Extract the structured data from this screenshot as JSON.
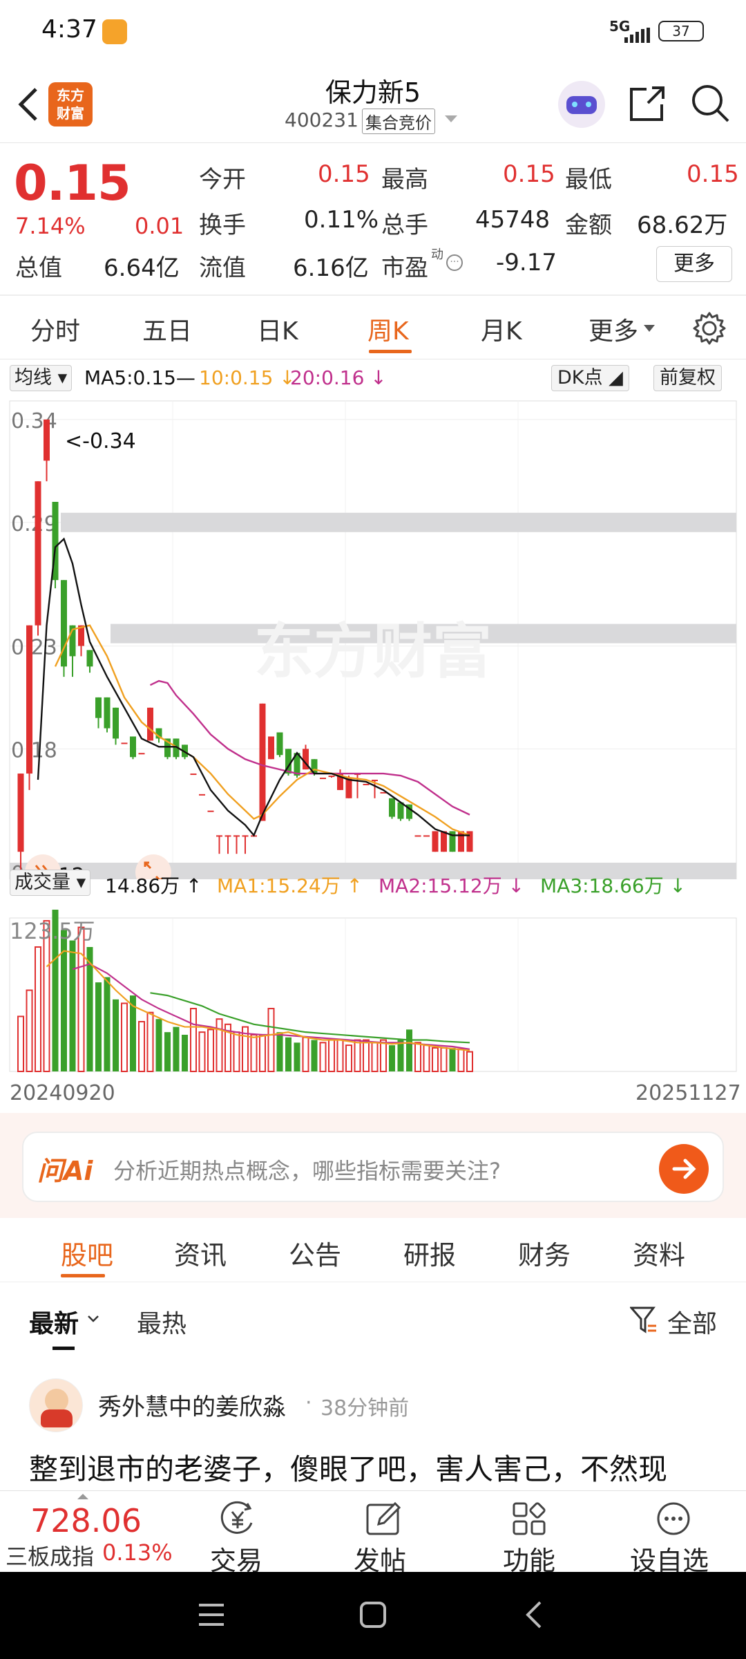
{
  "status_bar": {
    "time": "4:37",
    "network": "5G",
    "battery": "37"
  },
  "header": {
    "title": "保力新5",
    "code": "400231",
    "badge": "集合竞价",
    "logo_text": "东方财富"
  },
  "quote": {
    "price": "0.15",
    "change_pct": "7.14%",
    "change": "0.01",
    "fields": [
      {
        "label": "今开",
        "value": "0.15"
      },
      {
        "label": "最高",
        "value": "0.15"
      },
      {
        "label": "最低",
        "value": "0.15"
      },
      {
        "label": "换手",
        "value": "0.11%"
      },
      {
        "label": "总手",
        "value": "45748"
      },
      {
        "label": "金额",
        "value": "68.62万"
      },
      {
        "label": "总值",
        "value": "6.64亿"
      },
      {
        "label": "流值",
        "value": "6.16亿"
      },
      {
        "label": "市盈",
        "value": "-9.17"
      }
    ],
    "pe_sup": "动",
    "more_button": "更多"
  },
  "period_tabs": [
    "分时",
    "五日",
    "日K",
    "周K",
    "月K",
    "更多"
  ],
  "active_tab": "周K",
  "chart_toolbar": {
    "ma_select": "均线",
    "ma5": "MA5:0.15—",
    "ma10": "10:0.15 ↓",
    "ma20": "20:0.16 ↓",
    "dk": "DK点",
    "adjust": "前复权"
  },
  "chart_data": {
    "type": "candlestick",
    "y_ticks": [
      "0.34",
      "0.29",
      "0.23",
      "0.18",
      "0.12"
    ],
    "ylim": [
      0.12,
      0.345
    ],
    "max_label": "<-0.34",
    "min_label": "<-0.12",
    "watermark": "东方财富",
    "candles": [
      {
        "o": 0.13,
        "h": 0.168,
        "l": 0.12,
        "c": 0.168
      },
      {
        "o": 0.168,
        "h": 0.24,
        "l": 0.16,
        "c": 0.24
      },
      {
        "o": 0.24,
        "h": 0.31,
        "l": 0.235,
        "c": 0.31
      },
      {
        "o": 0.32,
        "h": 0.34,
        "l": 0.31,
        "c": 0.34
      },
      {
        "o": 0.3,
        "h": 0.3,
        "l": 0.258,
        "c": 0.262
      },
      {
        "o": 0.262,
        "h": 0.262,
        "l": 0.215,
        "c": 0.22
      },
      {
        "o": 0.24,
        "h": 0.24,
        "l": 0.215,
        "c": 0.225
      },
      {
        "o": 0.23,
        "h": 0.24,
        "l": 0.225,
        "c": 0.24
      },
      {
        "o": 0.228,
        "h": 0.228,
        "l": 0.217,
        "c": 0.22
      },
      {
        "o": 0.205,
        "h": 0.205,
        "l": 0.19,
        "c": 0.195
      },
      {
        "o": 0.205,
        "h": 0.205,
        "l": 0.188,
        "c": 0.19
      },
      {
        "o": 0.2,
        "h": 0.2,
        "l": 0.182,
        "c": 0.185
      },
      {
        "o": 0.183,
        "h": 0.183,
        "l": 0.183,
        "c": 0.183
      },
      {
        "o": 0.186,
        "h": 0.186,
        "l": 0.175,
        "c": 0.176
      },
      {
        "o": 0.178,
        "h": 0.178,
        "l": 0.178,
        "c": 0.178
      },
      {
        "o": 0.184,
        "h": 0.2,
        "l": 0.184,
        "c": 0.2
      },
      {
        "o": 0.19,
        "h": 0.19,
        "l": 0.183,
        "c": 0.185
      },
      {
        "o": 0.185,
        "h": 0.185,
        "l": 0.175,
        "c": 0.176
      },
      {
        "o": 0.185,
        "h": 0.185,
        "l": 0.175,
        "c": 0.176
      },
      {
        "o": 0.182,
        "h": 0.182,
        "l": 0.175,
        "c": 0.176
      },
      {
        "o": 0.168,
        "h": 0.168,
        "l": 0.168,
        "c": 0.168
      },
      {
        "o": 0.158,
        "h": 0.158,
        "l": 0.158,
        "c": 0.158
      },
      {
        "o": 0.15,
        "h": 0.15,
        "l": 0.15,
        "c": 0.15
      },
      {
        "o": 0.138,
        "h": 0.138,
        "l": 0.129,
        "c": 0.138
      },
      {
        "o": 0.138,
        "h": 0.138,
        "l": 0.129,
        "c": 0.138
      },
      {
        "o": 0.138,
        "h": 0.138,
        "l": 0.129,
        "c": 0.138
      },
      {
        "o": 0.138,
        "h": 0.138,
        "l": 0.129,
        "c": 0.138
      },
      {
        "o": 0.138,
        "h": 0.138,
        "l": 0.138,
        "c": 0.138
      },
      {
        "o": 0.145,
        "h": 0.202,
        "l": 0.145,
        "c": 0.202
      },
      {
        "o": 0.175,
        "h": 0.186,
        "l": 0.175,
        "c": 0.186
      },
      {
        "o": 0.188,
        "h": 0.188,
        "l": 0.176,
        "c": 0.177
      },
      {
        "o": 0.18,
        "h": 0.18,
        "l": 0.167,
        "c": 0.168
      },
      {
        "o": 0.178,
        "h": 0.178,
        "l": 0.166,
        "c": 0.167
      },
      {
        "o": 0.17,
        "h": 0.182,
        "l": 0.17,
        "c": 0.18
      },
      {
        "o": 0.175,
        "h": 0.175,
        "l": 0.167,
        "c": 0.168
      },
      {
        "o": 0.166,
        "h": 0.166,
        "l": 0.166,
        "c": 0.166
      },
      {
        "o": 0.167,
        "h": 0.167,
        "l": 0.166,
        "c": 0.167
      },
      {
        "o": 0.16,
        "h": 0.17,
        "l": 0.16,
        "c": 0.168
      },
      {
        "o": 0.156,
        "h": 0.167,
        "l": 0.156,
        "c": 0.166
      },
      {
        "o": 0.168,
        "h": 0.168,
        "l": 0.156,
        "c": 0.168
      },
      {
        "o": 0.163,
        "h": 0.163,
        "l": 0.163,
        "c": 0.163
      },
      {
        "o": 0.165,
        "h": 0.165,
        "l": 0.156,
        "c": 0.165
      },
      {
        "o": 0.159,
        "h": 0.159,
        "l": 0.159,
        "c": 0.159
      },
      {
        "o": 0.156,
        "h": 0.156,
        "l": 0.146,
        "c": 0.147
      },
      {
        "o": 0.154,
        "h": 0.154,
        "l": 0.145,
        "c": 0.146
      },
      {
        "o": 0.153,
        "h": 0.153,
        "l": 0.145,
        "c": 0.146
      },
      {
        "o": 0.138,
        "h": 0.138,
        "l": 0.138,
        "c": 0.138
      },
      {
        "o": 0.138,
        "h": 0.138,
        "l": 0.138,
        "c": 0.138
      },
      {
        "o": 0.13,
        "h": 0.14,
        "l": 0.13,
        "c": 0.14
      },
      {
        "o": 0.13,
        "h": 0.14,
        "l": 0.13,
        "c": 0.14
      },
      {
        "o": 0.14,
        "h": 0.14,
        "l": 0.13,
        "c": 0.13
      },
      {
        "o": 0.13,
        "h": 0.14,
        "l": 0.13,
        "c": 0.14
      },
      {
        "o": 0.13,
        "h": 0.14,
        "l": 0.13,
        "c": 0.14
      }
    ],
    "ma5": [
      [
        2,
        0.165
      ],
      [
        3,
        0.24
      ],
      [
        4,
        0.278
      ],
      [
        5,
        0.282
      ],
      [
        6,
        0.27
      ],
      [
        7,
        0.25
      ],
      [
        8,
        0.232
      ],
      [
        10,
        0.215
      ],
      [
        12,
        0.2
      ],
      [
        14,
        0.185
      ],
      [
        16,
        0.181
      ],
      [
        18,
        0.181
      ],
      [
        20,
        0.176
      ],
      [
        22,
        0.16
      ],
      [
        24,
        0.15
      ],
      [
        26,
        0.143
      ],
      [
        27,
        0.138
      ],
      [
        28,
        0.148
      ],
      [
        30,
        0.165
      ],
      [
        32,
        0.178
      ],
      [
        34,
        0.168
      ],
      [
        36,
        0.168
      ],
      [
        38,
        0.165
      ],
      [
        40,
        0.164
      ],
      [
        42,
        0.16
      ],
      [
        44,
        0.154
      ],
      [
        46,
        0.148
      ],
      [
        48,
        0.141
      ],
      [
        50,
        0.138
      ],
      [
        52,
        0.138
      ]
    ],
    "ma10": [
      [
        4,
        0.22
      ],
      [
        6,
        0.238
      ],
      [
        8,
        0.24
      ],
      [
        10,
        0.225
      ],
      [
        12,
        0.205
      ],
      [
        14,
        0.193
      ],
      [
        16,
        0.186
      ],
      [
        18,
        0.181
      ],
      [
        20,
        0.176
      ],
      [
        22,
        0.168
      ],
      [
        24,
        0.158
      ],
      [
        26,
        0.15
      ],
      [
        27,
        0.146
      ],
      [
        28,
        0.148
      ],
      [
        30,
        0.157
      ],
      [
        32,
        0.165
      ],
      [
        34,
        0.17
      ],
      [
        36,
        0.168
      ],
      [
        38,
        0.166
      ],
      [
        40,
        0.165
      ],
      [
        42,
        0.162
      ],
      [
        44,
        0.157
      ],
      [
        46,
        0.152
      ],
      [
        48,
        0.147
      ],
      [
        50,
        0.141
      ],
      [
        52,
        0.138
      ]
    ],
    "ma20": [
      [
        15,
        0.211
      ],
      [
        16,
        0.213
      ],
      [
        17,
        0.212
      ],
      [
        18,
        0.206
      ],
      [
        20,
        0.197
      ],
      [
        22,
        0.187
      ],
      [
        24,
        0.18
      ],
      [
        26,
        0.175
      ],
      [
        28,
        0.172
      ],
      [
        30,
        0.17
      ],
      [
        32,
        0.168
      ],
      [
        34,
        0.168
      ],
      [
        36,
        0.168
      ],
      [
        38,
        0.168
      ],
      [
        40,
        0.168
      ],
      [
        42,
        0.168
      ],
      [
        44,
        0.167
      ],
      [
        46,
        0.164
      ],
      [
        48,
        0.158
      ],
      [
        50,
        0.152
      ],
      [
        52,
        0.148
      ]
    ],
    "bands": [
      0.29,
      0.236,
      0.12
    ],
    "volume": {
      "label_select": "成交量",
      "latest": "14.86万 ↑",
      "ma1": "MA1:15.24万 ↑",
      "ma2": "MA2:15.12万 ↓",
      "ma3": "MA3:18.66万 ↓",
      "max": "123.5万",
      "values": [
        42,
        62,
        95,
        115,
        123.5,
        108,
        100,
        110,
        95,
        68,
        72,
        55,
        52,
        58,
        38,
        45,
        40,
        30,
        34,
        28,
        48,
        30,
        32,
        40,
        36,
        30,
        34,
        28,
        28,
        48,
        30,
        26,
        22,
        26,
        24,
        22,
        24,
        24,
        20,
        24,
        24,
        22,
        24,
        20,
        24,
        32,
        22,
        20,
        18,
        18,
        18,
        17,
        15
      ],
      "ma1_line": [
        [
          3,
          80
        ],
        [
          5,
          92
        ],
        [
          7,
          90
        ],
        [
          9,
          76
        ],
        [
          11,
          62
        ],
        [
          13,
          50
        ],
        [
          15,
          44
        ],
        [
          17,
          38
        ],
        [
          19,
          34
        ],
        [
          21,
          34
        ],
        [
          23,
          32
        ],
        [
          25,
          28
        ],
        [
          27,
          26
        ],
        [
          29,
          28
        ],
        [
          31,
          30
        ],
        [
          33,
          26
        ],
        [
          35,
          24
        ],
        [
          37,
          24
        ],
        [
          39,
          22
        ],
        [
          41,
          22
        ],
        [
          43,
          21
        ],
        [
          45,
          22
        ],
        [
          47,
          20
        ],
        [
          49,
          18
        ],
        [
          52,
          16
        ]
      ],
      "ma2_line": [
        [
          6,
          78
        ],
        [
          8,
          82
        ],
        [
          10,
          75
        ],
        [
          12,
          65
        ],
        [
          14,
          55
        ],
        [
          16,
          48
        ],
        [
          18,
          42
        ],
        [
          20,
          36
        ],
        [
          22,
          34
        ],
        [
          24,
          31
        ],
        [
          26,
          29
        ],
        [
          28,
          28
        ],
        [
          30,
          28
        ],
        [
          32,
          27
        ],
        [
          34,
          26
        ],
        [
          36,
          25
        ],
        [
          38,
          24
        ],
        [
          40,
          23
        ],
        [
          42,
          22
        ],
        [
          44,
          22
        ],
        [
          46,
          21
        ],
        [
          48,
          20
        ],
        [
          50,
          19
        ],
        [
          52,
          17
        ]
      ],
      "ma3_line": [
        [
          15,
          60
        ],
        [
          17,
          58
        ],
        [
          19,
          54
        ],
        [
          21,
          50
        ],
        [
          23,
          44
        ],
        [
          25,
          40
        ],
        [
          27,
          36
        ],
        [
          29,
          34
        ],
        [
          31,
          32
        ],
        [
          33,
          30
        ],
        [
          35,
          29
        ],
        [
          37,
          28
        ],
        [
          39,
          27
        ],
        [
          41,
          26
        ],
        [
          43,
          25
        ],
        [
          45,
          24
        ],
        [
          47,
          24
        ],
        [
          49,
          23
        ],
        [
          52,
          22
        ]
      ]
    },
    "x_start": "20240920",
    "x_end": "20251127"
  },
  "ai": {
    "logo": "问Ai",
    "placeholder": "分析近期热点概念，哪些指标需要关注?"
  },
  "sub_tabs": [
    "股吧",
    "资讯",
    "公告",
    "研报",
    "财务",
    "资料"
  ],
  "feed": {
    "sort": [
      "最新",
      "最热"
    ],
    "filter": "全部",
    "post": {
      "author": "秀外慧中的姜欣淼",
      "time": "38分钟前",
      "text": "整到退市的老婆子，傻眼了吧，害人害己，不然现"
    }
  },
  "bottom": {
    "index_value": "728.06",
    "index_name": "三板成指",
    "index_pct": "0.13%",
    "actions": [
      "交易",
      "发帖",
      "功能",
      "设自选"
    ]
  },
  "colors": {
    "up": "#e03030",
    "down": "#3aa02a",
    "ma5": "#111111",
    "ma10": "#f0a020",
    "ma20": "#c0308c",
    "accent": "#e8661c"
  }
}
